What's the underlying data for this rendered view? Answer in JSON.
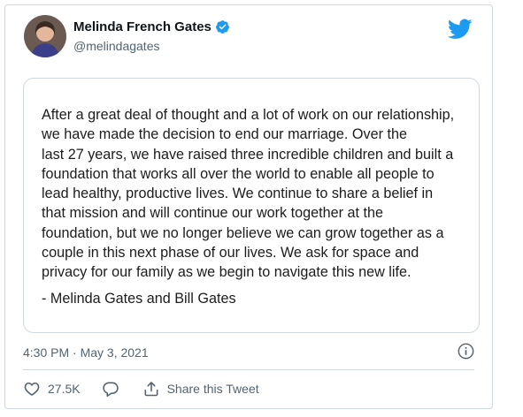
{
  "tweet": {
    "author": {
      "display_name": "Melinda French Gates",
      "handle": "@melindagates",
      "verified": true
    },
    "statement": {
      "lines": [
        "After a great deal of thought and a lot of work on our relationship,",
        "we have made the decision to end our marriage. Over the",
        "last 27 years, we have raised three incredible children and built a",
        "foundation that works all over the world to enable all people to",
        "lead healthy, productive lives. We continue to share a belief in",
        "that mission and will continue our work together at the",
        "foundation, but we no longer believe we can grow together as a",
        "couple in this next phase of our lives. We ask for space and",
        "privacy for our family as we begin to navigate this new life."
      ],
      "signature": "- Melinda Gates and Bill Gates"
    },
    "timestamp": "4:30 PM · May 3, 2021",
    "actions": {
      "like_count": "27.5K",
      "share_label": "Share this Tweet"
    }
  },
  "icons": {
    "brand": "twitter-bird-icon",
    "verified": "verified-badge-icon",
    "info": "info-icon",
    "like": "heart-icon",
    "reply": "reply-bubble-icon",
    "share": "share-icon"
  },
  "colors": {
    "brand_blue": "#1d9bf0",
    "secondary_text": "#536471",
    "border": "#cfd9de"
  }
}
